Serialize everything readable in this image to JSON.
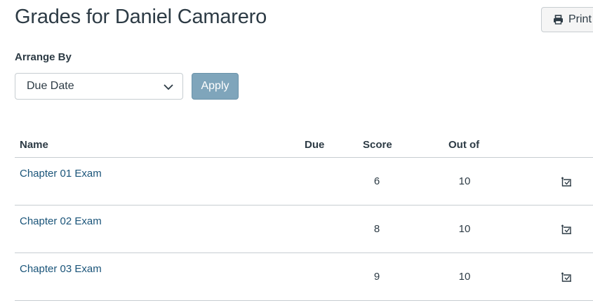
{
  "header": {
    "title": "Grades for Daniel Camarero",
    "print_label": "Print"
  },
  "arrange": {
    "label": "Arrange By",
    "selected": "Due Date",
    "apply_label": "Apply"
  },
  "table": {
    "columns": {
      "name": "Name",
      "due": "Due",
      "score": "Score",
      "out_of": "Out of"
    },
    "rows": [
      {
        "name": "Chapter 01 Exam",
        "due": "",
        "score": "6",
        "out_of": "10",
        "icon": "rubric-icon"
      },
      {
        "name": "Chapter 02 Exam",
        "due": "",
        "score": "8",
        "out_of": "10",
        "icon": "rubric-icon"
      },
      {
        "name": "Chapter 03 Exam",
        "due": "",
        "score": "9",
        "out_of": "10",
        "icon": "rubric-icon"
      }
    ]
  },
  "colors": {
    "text": "#2d3b45",
    "link": "#1a5479",
    "apply_bg": "#7fa5bb",
    "divider": "#c7cdd1"
  }
}
